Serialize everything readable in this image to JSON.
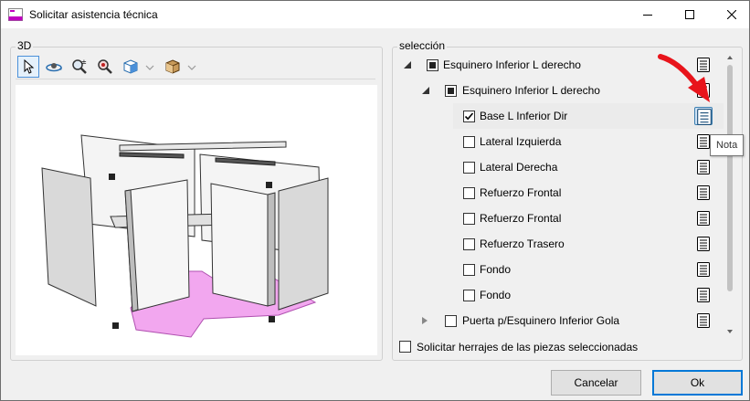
{
  "window": {
    "title": "Solicitar asistencia técnica",
    "controls": [
      "minimize",
      "maximize",
      "close"
    ]
  },
  "view3d": {
    "group_label": "3D",
    "toolbar": [
      "select-pointer-icon",
      "orbit-icon",
      "zoom-icon",
      "zoom-extents-icon",
      "view-cube-icon",
      "box-shade-icon"
    ]
  },
  "selection": {
    "group_label": "selección",
    "tree": [
      {
        "label": "Esquinero Inferior L derecho",
        "level": 0,
        "expander": "expanded",
        "state": "indeterminate"
      },
      {
        "label": "Esquinero Inferior L derecho",
        "level": 1,
        "expander": "expanded",
        "state": "indeterminate"
      },
      {
        "label": "Base L Inferior Dir",
        "level": 2,
        "expander": "none",
        "state": "checked",
        "selected": true
      },
      {
        "label": "Lateral Izquierda",
        "level": 2,
        "expander": "none",
        "state": "unchecked"
      },
      {
        "label": "Lateral Derecha",
        "level": 2,
        "expander": "none",
        "state": "unchecked"
      },
      {
        "label": "Refuerzo Frontal",
        "level": 2,
        "expander": "none",
        "state": "unchecked"
      },
      {
        "label": "Refuerzo Frontal",
        "level": 2,
        "expander": "none",
        "state": "unchecked"
      },
      {
        "label": "Refuerzo Trasero",
        "level": 2,
        "expander": "none",
        "state": "unchecked"
      },
      {
        "label": "Fondo",
        "level": 2,
        "expander": "none",
        "state": "unchecked"
      },
      {
        "label": "Fondo",
        "level": 2,
        "expander": "none",
        "state": "unchecked"
      },
      {
        "label": "Puerta p/Esquinero Inferior Gola",
        "level": 1,
        "expander": "collapsed",
        "state": "unchecked"
      }
    ],
    "tooltip": "Nota"
  },
  "herrajes_label": "Solicitar herrajes de las piezas seleccionadas",
  "buttons": {
    "cancel": "Cancelar",
    "ok": "Ok"
  },
  "colors": {
    "accent": "#0078d7",
    "highlight_piece": "#f2a7ef",
    "annotation_arrow": "#e8141b"
  }
}
